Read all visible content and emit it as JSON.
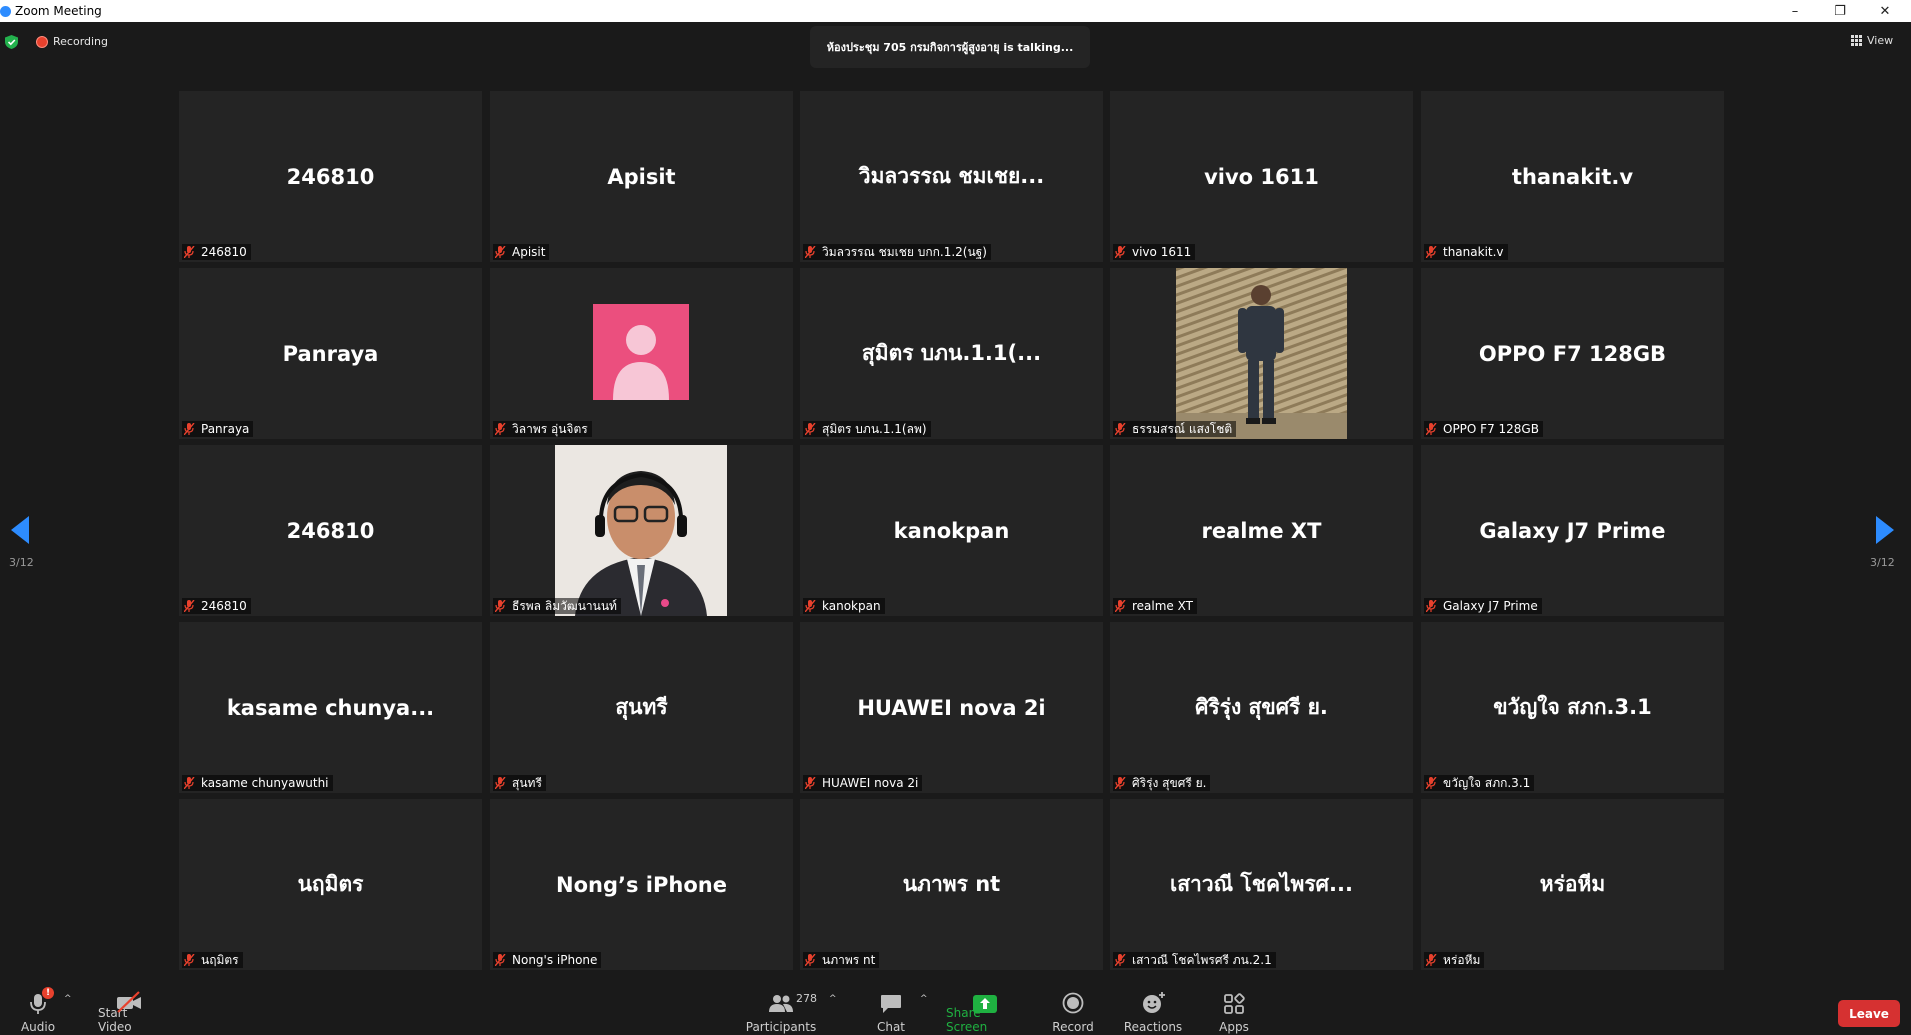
{
  "window": {
    "title": "Zoom Meeting",
    "minimize": "–",
    "restore": "❐",
    "close": "✕"
  },
  "topbar": {
    "recording": "Recording",
    "speaker_notice": "ห้องประชุม 705 กรมกิจการผู้สูงอายุ is  talking...",
    "view": "View"
  },
  "pagination": {
    "left": "3/12",
    "right": "3/12"
  },
  "tiles": [
    {
      "big": "246810",
      "label": "246810"
    },
    {
      "big": "Apisit",
      "label": "Apisit"
    },
    {
      "big": "วิมลวรรณ ชมเชย...",
      "label": "วิมลวรรณ ชมเชย บกก.1.2(นฐ)"
    },
    {
      "big": "vivo 1611",
      "label": "vivo 1611"
    },
    {
      "big": "thanakit.v",
      "label": "thanakit.v"
    },
    {
      "big": "Panraya",
      "label": "Panraya"
    },
    {
      "big": "",
      "label": "วิลาพร อุ่นจิตร"
    },
    {
      "big": "สุมิตร   บภน.1.1(...",
      "label": "สุมิตร   บภน.1.1(ลพ)"
    },
    {
      "big": "",
      "label": "ธรรมสรณ์ แสงโชติ"
    },
    {
      "big": "OPPO F7 128GB",
      "label": "OPPO F7 128GB"
    },
    {
      "big": "246810",
      "label": "246810"
    },
    {
      "big": "",
      "label": "ธีรพล ลิมวัฒนานนท์"
    },
    {
      "big": "kanokpan",
      "label": "kanokpan"
    },
    {
      "big": "realme XT",
      "label": "realme XT"
    },
    {
      "big": "Galaxy J7 Prime",
      "label": "Galaxy J7 Prime"
    },
    {
      "big": "kasame  chunya...",
      "label": "kasame chunyawuthi"
    },
    {
      "big": "สุนทรี",
      "label": "สุนทรี"
    },
    {
      "big": "HUAWEI nova 2i",
      "label": "HUAWEI nova 2i"
    },
    {
      "big": "ศิริรุ่ง สุขศรี ย.",
      "label": "ศิริรุ่ง สุขศรี ย."
    },
    {
      "big": "ขวัญใจ สภก.3.1",
      "label": "ขวัญใจ สภก.3.1"
    },
    {
      "big": "นฤมิตร",
      "label": "นฤมิตร"
    },
    {
      "big": "Nong’s iPhone",
      "label": "Nong's iPhone"
    },
    {
      "big": "นภาพร nt",
      "label": "นภาพร nt"
    },
    {
      "big": "เสาวณี โชคไพรศ...",
      "label": "เสาวณี โชคไพรศรี ภน.2.1"
    },
    {
      "big": "หร่อหีม",
      "label": "หร่อหีม"
    }
  ],
  "toolbar": {
    "audio": "Audio",
    "audio_badge": "!",
    "start_video": "Start Video",
    "participants": "Participants",
    "participants_count": "278",
    "chat": "Chat",
    "share_screen": "Share Screen",
    "record": "Record",
    "reactions": "Reactions",
    "apps": "Apps",
    "leave": "Leave",
    "caret": "^"
  },
  "colors": {
    "accent": "#2d8cff",
    "leave": "#d63131",
    "share": "#1fb141",
    "muted_mic": "#e8412d",
    "tile_bg": "#242424"
  }
}
